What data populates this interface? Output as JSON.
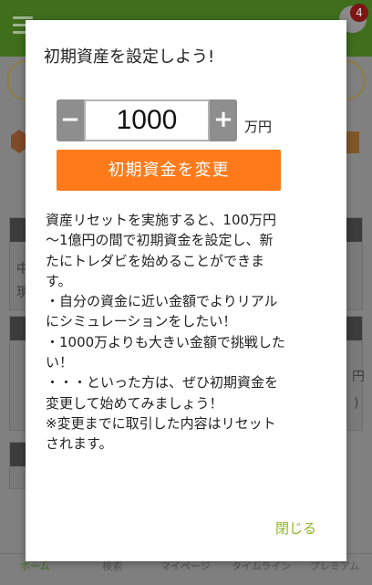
{
  "background": {
    "notification_count": "4",
    "tabs": [
      "ホーム",
      "検索",
      "マイページ",
      "タイムライン",
      "プレミアム"
    ],
    "partial_text": {
      "left_1": "中",
      "left_2": "現",
      "right_1": "円",
      "right_2": ")"
    }
  },
  "dialog": {
    "title": "初期資産を設定しよう!",
    "stepper": {
      "minus_label": "−",
      "plus_label": "+",
      "value": "1000",
      "unit": "万円"
    },
    "change_button_label": "初期資金を変更",
    "description_lines": [
      "資産リセットを実施すると、100万円",
      "〜1億円の間で初期資金を設定し、新",
      "たにトレダビを始めることができま",
      "す。",
      "・自分の資金に近い金額でよりリアル",
      "にシミュレーションをしたい！",
      "・1000万よりも大きい金額で挑戦した",
      "い！",
      "・・・といった方は、ぜひ初期資金を",
      "変更して始めてみましょう！",
      "※変更までに取引した内容はリセット",
      "されます。"
    ],
    "close_label": "閉じる"
  },
  "colors": {
    "accent_orange": "#ff7a1a",
    "close_green": "#8ab81e",
    "header_green": "#3f6e1d"
  }
}
